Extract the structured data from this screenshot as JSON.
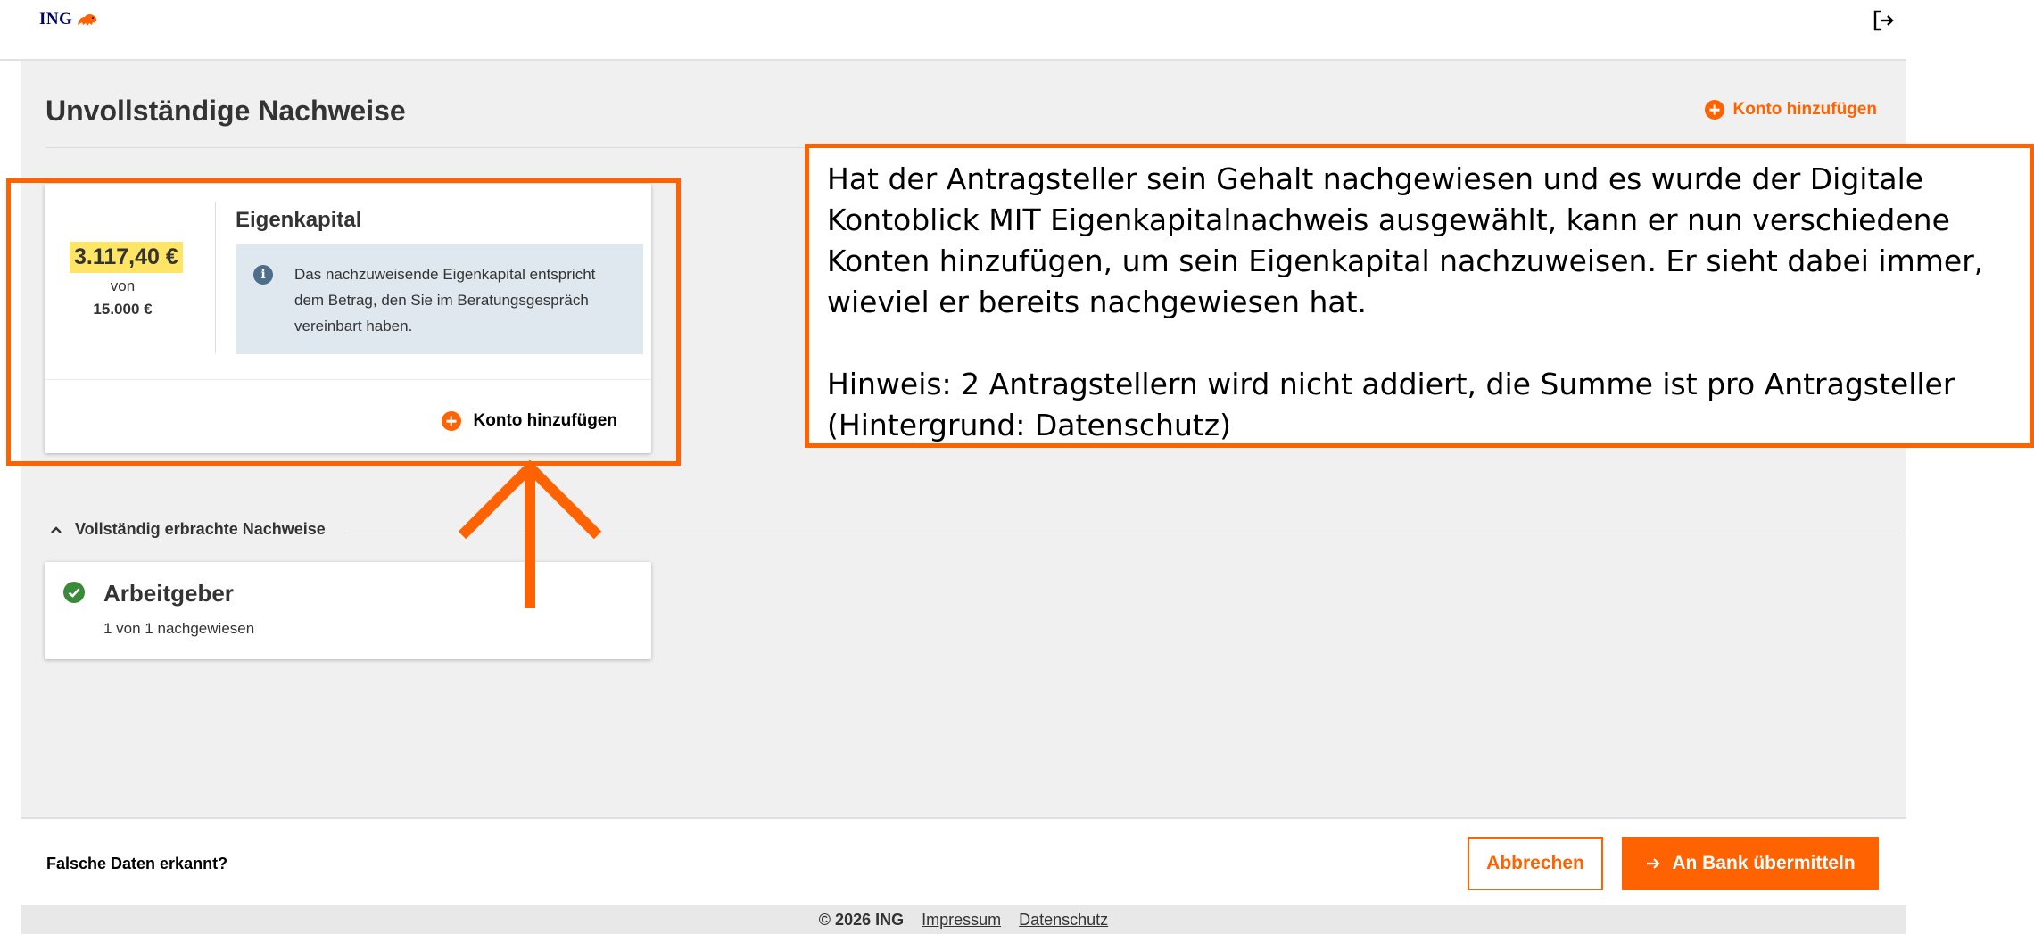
{
  "header": {
    "logo_text": "ING",
    "logo_icon": "lion-icon",
    "logout_icon": "logout-icon"
  },
  "page": {
    "title": "Unvollständige Nachweise",
    "add_account_label": "Konto hinzufügen"
  },
  "equity_card": {
    "amount": "3.117,40 €",
    "of_label": "von",
    "total": "15.000 €",
    "title": "Eigenkapital",
    "info_text": "Das nachzuweisende Eigenkapital entspricht dem Betrag, den Sie im Beratungsgespräch vereinbart haben.",
    "add_account_label": "Konto hinzufügen"
  },
  "annotation": {
    "text": "Hat der Antragsteller sein Gehalt nachgewiesen und es wurde der Digitale Kontoblick MIT Eigenkapitalnachweis ausgewählt, kann er nun verschiedene Konten hinzufügen, um sein Eigenkapital nachzuweisen. Er sieht dabei immer, wieviel er bereits nachgewiesen hat.\n\nHinweis: 2 Antragstellern wird nicht addiert, die Summe ist pro Antragsteller (Hintergrund: Datenschutz)",
    "color": "#ff6200"
  },
  "completed": {
    "section_label": "Vollständig erbrachte Nachweise",
    "items": [
      {
        "title": "Arbeitgeber",
        "status": "1 von 1 nachgewiesen"
      }
    ]
  },
  "actions": {
    "wrong_data": "Falsche Daten erkannt?",
    "cancel": "Abbrechen",
    "submit": "An Bank übermitteln"
  },
  "footer": {
    "copyright": "© 2026 ING",
    "links": [
      "Impressum",
      "Datenschutz"
    ]
  },
  "colors": {
    "accent": "#ff6200",
    "amount_highlight": "#ffe566",
    "info_bg": "#dfe8ee",
    "success": "#3a8a3a"
  }
}
